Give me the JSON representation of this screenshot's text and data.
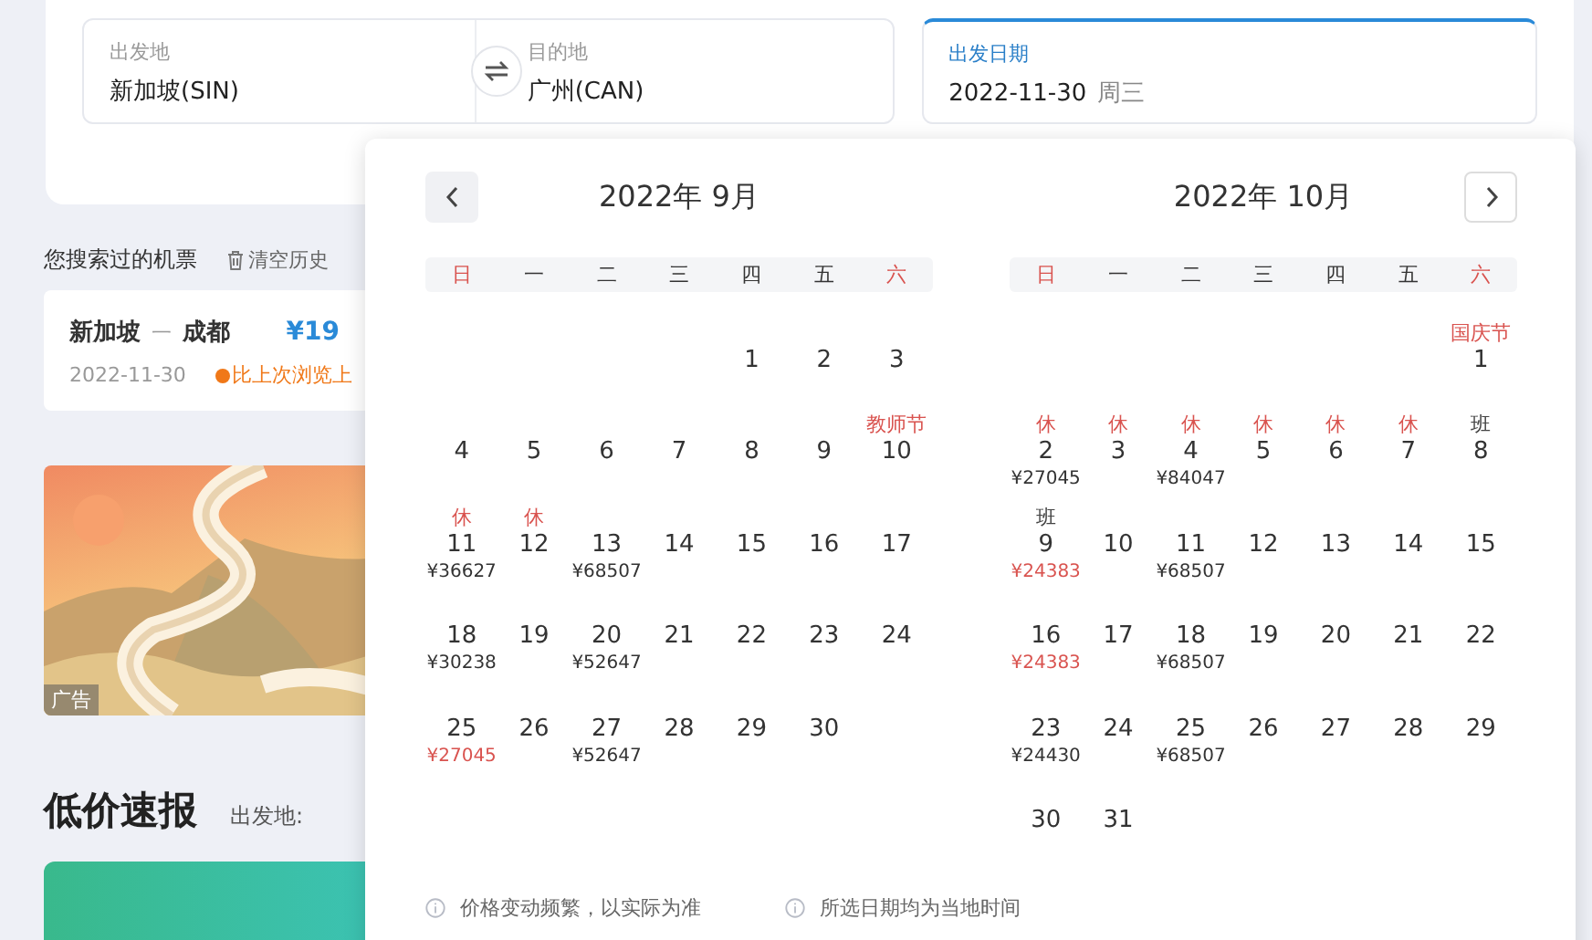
{
  "search": {
    "origin": {
      "label": "出发地",
      "value": "新加坡(SIN)"
    },
    "destination": {
      "label": "目的地",
      "value": "广州(CAN)"
    },
    "date": {
      "label": "出发日期",
      "value": "2022-11-30",
      "weekday": "周三",
      "focused": true
    }
  },
  "history": {
    "title": "您搜索过的机票",
    "clear": "清空历史",
    "cards": [
      {
        "route_from": "新加坡",
        "dash": "一",
        "route_to": "成都",
        "price": "¥19",
        "date": "2022-11-30",
        "note": "比上次浏览上"
      }
    ]
  },
  "banner": {
    "tag": "广告"
  },
  "deals": {
    "title": "低价速报",
    "origin_label": "出发地:"
  },
  "calendar": {
    "months": [
      {
        "title": "2022年 9月",
        "prev_button": true,
        "next_button": false,
        "weekdays": [
          {
            "label": "日",
            "weekend": true
          },
          {
            "label": "一",
            "weekend": false
          },
          {
            "label": "二",
            "weekend": false
          },
          {
            "label": "三",
            "weekend": false
          },
          {
            "label": "四",
            "weekend": false
          },
          {
            "label": "五",
            "weekend": false
          },
          {
            "label": "六",
            "weekend": true
          }
        ],
        "cells": [
          {
            "kind": "blank"
          },
          {
            "kind": "blank"
          },
          {
            "kind": "blank"
          },
          {
            "kind": "blank"
          },
          {
            "kind": "day",
            "day": "1"
          },
          {
            "kind": "day",
            "day": "2"
          },
          {
            "kind": "day",
            "day": "3"
          },
          {
            "kind": "day",
            "day": "4"
          },
          {
            "kind": "day",
            "day": "5"
          },
          {
            "kind": "day",
            "day": "6"
          },
          {
            "kind": "day",
            "day": "7"
          },
          {
            "kind": "day",
            "day": "8"
          },
          {
            "kind": "day",
            "day": "9"
          },
          {
            "kind": "day",
            "day": "10",
            "label": "教师节",
            "label_red": true
          },
          {
            "kind": "day",
            "day": "11",
            "label": "休",
            "label_red": true,
            "price": "¥36627",
            "price_low": false
          },
          {
            "kind": "day",
            "day": "12",
            "label": "休",
            "label_red": true
          },
          {
            "kind": "day",
            "day": "13",
            "price": "¥68507",
            "price_low": false
          },
          {
            "kind": "day",
            "day": "14"
          },
          {
            "kind": "day",
            "day": "15"
          },
          {
            "kind": "day",
            "day": "16"
          },
          {
            "kind": "day",
            "day": "17"
          },
          {
            "kind": "day",
            "day": "18",
            "price": "¥30238",
            "price_low": false
          },
          {
            "kind": "day",
            "day": "19"
          },
          {
            "kind": "day",
            "day": "20",
            "price": "¥52647",
            "price_low": false
          },
          {
            "kind": "day",
            "day": "21"
          },
          {
            "kind": "day",
            "day": "22"
          },
          {
            "kind": "day",
            "day": "23"
          },
          {
            "kind": "day",
            "day": "24"
          },
          {
            "kind": "day",
            "day": "25",
            "price": "¥27045",
            "price_low": true
          },
          {
            "kind": "day",
            "day": "26"
          },
          {
            "kind": "day",
            "day": "27",
            "price": "¥52647",
            "price_low": false
          },
          {
            "kind": "day",
            "day": "28"
          },
          {
            "kind": "day",
            "day": "29"
          },
          {
            "kind": "day",
            "day": "30"
          }
        ]
      },
      {
        "title": "2022年 10月",
        "prev_button": false,
        "next_button": true,
        "weekdays": [
          {
            "label": "日",
            "weekend": true
          },
          {
            "label": "一",
            "weekend": false
          },
          {
            "label": "二",
            "weekend": false
          },
          {
            "label": "三",
            "weekend": false
          },
          {
            "label": "四",
            "weekend": false
          },
          {
            "label": "五",
            "weekend": false
          },
          {
            "label": "六",
            "weekend": true
          }
        ],
        "cells": [
          {
            "kind": "blank"
          },
          {
            "kind": "blank"
          },
          {
            "kind": "blank"
          },
          {
            "kind": "blank"
          },
          {
            "kind": "blank"
          },
          {
            "kind": "blank"
          },
          {
            "kind": "day",
            "day": "1",
            "label": "国庆节",
            "label_red": true
          },
          {
            "kind": "day",
            "day": "2",
            "label": "休",
            "label_red": true,
            "price": "¥27045",
            "price_low": false
          },
          {
            "kind": "day",
            "day": "3",
            "label": "休",
            "label_red": true
          },
          {
            "kind": "day",
            "day": "4",
            "label": "休",
            "label_red": true,
            "price": "¥84047",
            "price_low": false
          },
          {
            "kind": "day",
            "day": "5",
            "label": "休",
            "label_red": true
          },
          {
            "kind": "day",
            "day": "6",
            "label": "休",
            "label_red": true
          },
          {
            "kind": "day",
            "day": "7",
            "label": "休",
            "label_red": true
          },
          {
            "kind": "day",
            "day": "8",
            "label": "班",
            "label_red": false
          },
          {
            "kind": "day",
            "day": "9",
            "label": "班",
            "label_red": false,
            "price": "¥24383",
            "price_low": true
          },
          {
            "kind": "day",
            "day": "10"
          },
          {
            "kind": "day",
            "day": "11",
            "price": "¥68507",
            "price_low": false
          },
          {
            "kind": "day",
            "day": "12"
          },
          {
            "kind": "day",
            "day": "13"
          },
          {
            "kind": "day",
            "day": "14"
          },
          {
            "kind": "day",
            "day": "15"
          },
          {
            "kind": "day",
            "day": "16",
            "price": "¥24383",
            "price_low": true
          },
          {
            "kind": "day",
            "day": "17"
          },
          {
            "kind": "day",
            "day": "18",
            "price": "¥68507",
            "price_low": false
          },
          {
            "kind": "day",
            "day": "19"
          },
          {
            "kind": "day",
            "day": "20"
          },
          {
            "kind": "day",
            "day": "21"
          },
          {
            "kind": "day",
            "day": "22"
          },
          {
            "kind": "day",
            "day": "23",
            "price": "¥24430",
            "price_low": false
          },
          {
            "kind": "day",
            "day": "24"
          },
          {
            "kind": "day",
            "day": "25",
            "price": "¥68507",
            "price_low": false
          },
          {
            "kind": "day",
            "day": "26"
          },
          {
            "kind": "day",
            "day": "27"
          },
          {
            "kind": "day",
            "day": "28"
          },
          {
            "kind": "day",
            "day": "29"
          },
          {
            "kind": "day",
            "day": "30"
          },
          {
            "kind": "day",
            "day": "31"
          }
        ]
      }
    ],
    "notes": [
      "价格变动频繁，以实际为准",
      "所选日期均为当地时间"
    ]
  }
}
